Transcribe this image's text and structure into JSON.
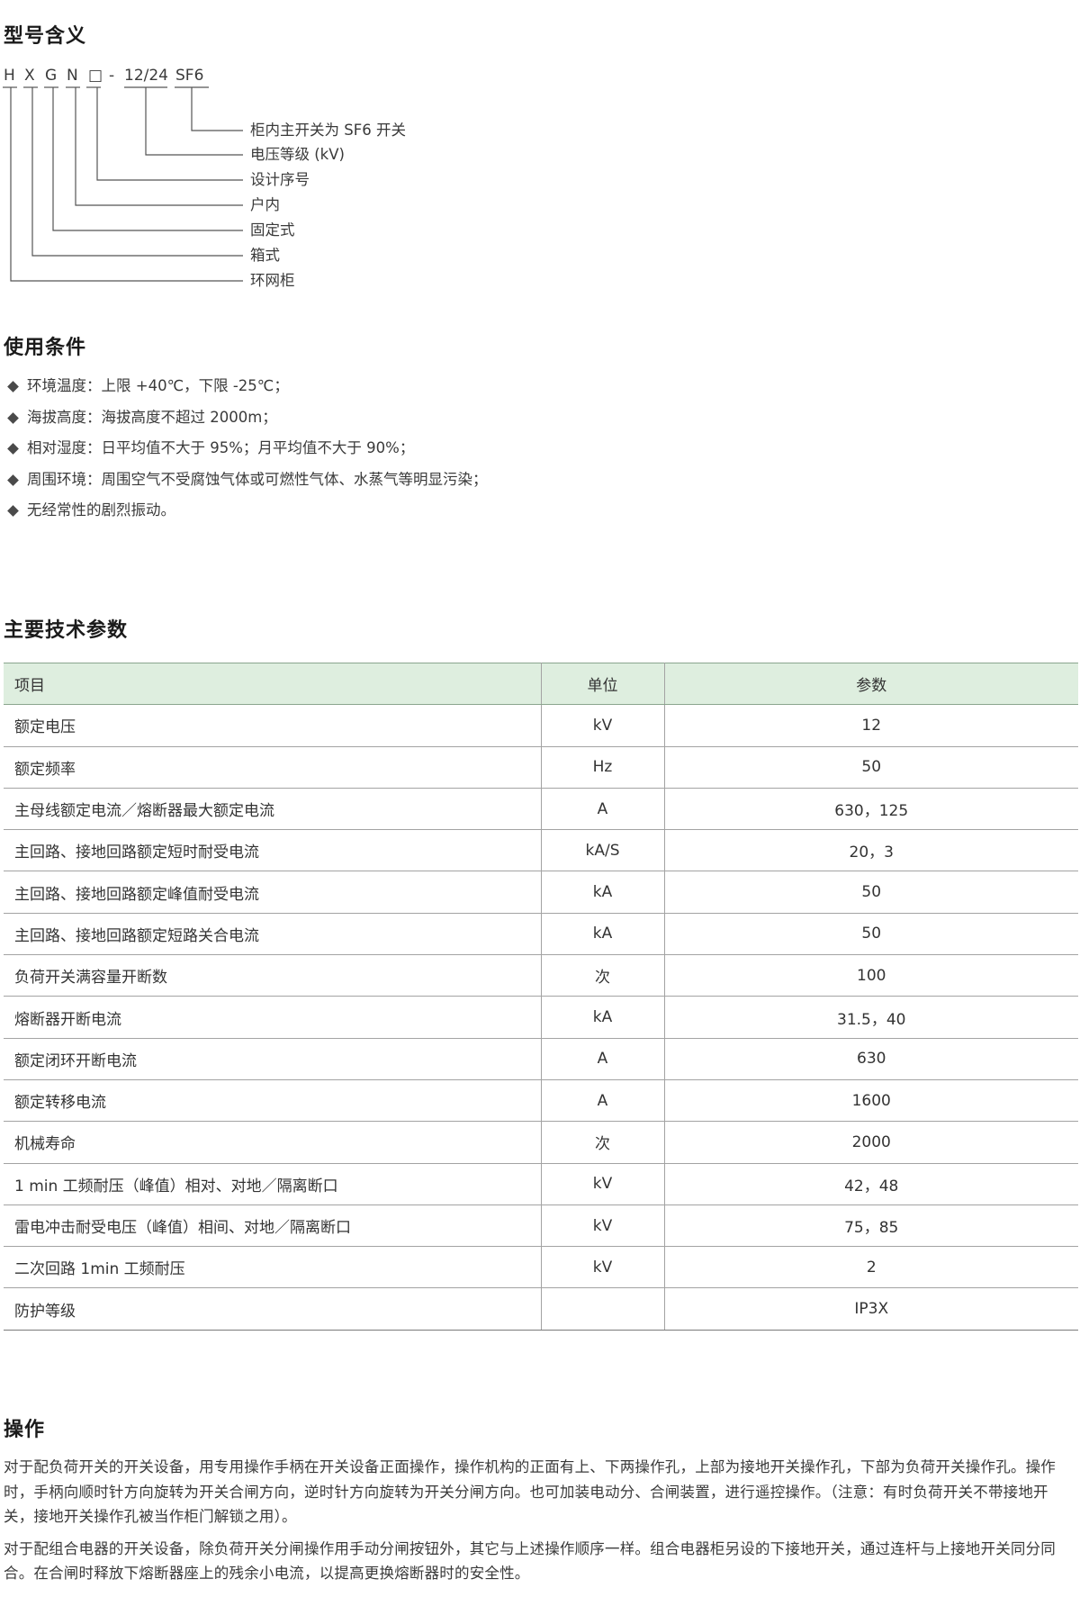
{
  "model_section": {
    "title": "型号含义",
    "code_parts": [
      "H",
      "X",
      "G",
      "N",
      "□",
      "-",
      "12/24",
      "SF6"
    ],
    "meanings": [
      "柜内主开关为 SF6 开关",
      "电压等级 (kV)",
      "设计序号",
      "户内",
      "固定式",
      "箱式",
      "环网柜"
    ]
  },
  "conditions_section": {
    "title": "使用条件",
    "items": [
      "环境温度：上限 +40℃，下限 -25℃；",
      "海拔高度：海拔高度不超过 2000m；",
      "相对湿度：日平均值不大于 95%；月平均值不大于 90%；",
      "周围环境：周围空气不受腐蚀气体或可燃性气体、水蒸气等明显污染；",
      "无经常性的剧烈振动。"
    ]
  },
  "params_section": {
    "title": "主要技术参数",
    "headers": {
      "item": "项目",
      "unit": "单位",
      "value": "参数"
    },
    "rows": [
      {
        "item": "额定电压",
        "unit": "kV",
        "value": "12"
      },
      {
        "item": "额定频率",
        "unit": "Hz",
        "value": "50"
      },
      {
        "item": "主母线额定电流／熔断器最大额定电流",
        "unit": "A",
        "value": "630，125"
      },
      {
        "item": "主回路、接地回路额定短时耐受电流",
        "unit": "kA/S",
        "value": "20，3"
      },
      {
        "item": "主回路、接地回路额定峰值耐受电流",
        "unit": "kA",
        "value": "50"
      },
      {
        "item": "主回路、接地回路额定短路关合电流",
        "unit": "kA",
        "value": "50"
      },
      {
        "item": "负荷开关满容量开断数",
        "unit": "次",
        "value": "100"
      },
      {
        "item": "熔断器开断电流",
        "unit": "kA",
        "value": "31.5，40"
      },
      {
        "item": "额定闭环开断电流",
        "unit": "A",
        "value": "630"
      },
      {
        "item": "额定转移电流",
        "unit": "A",
        "value": "1600"
      },
      {
        "item": "机械寿命",
        "unit": "次",
        "value": "2000"
      },
      {
        "item": "1 min 工频耐压（峰值）相对、对地／隔离断口",
        "unit": "kV",
        "value": "42，48"
      },
      {
        "item": "雷电冲击耐受电压（峰值）相间、对地／隔离断口",
        "unit": "kV",
        "value": "75，85"
      },
      {
        "item": "二次回路 1min 工频耐压",
        "unit": "kV",
        "value": "2"
      },
      {
        "item": "防护等级",
        "unit": "",
        "value": "IP3X"
      }
    ]
  },
  "operation_section": {
    "title": "操作",
    "paragraphs": [
      "对于配负荷开关的开关设备，用专用操作手柄在开关设备正面操作，操作机构的正面有上、下两操作孔，上部为接地开关操作孔，下部为负荷开关操作孔。操作时，手柄向顺时针方向旋转为开关合闸方向，逆时针方向旋转为开关分闸方向。也可加装电动分、合闸装置，进行遥控操作。（注意：有时负荷开关不带接地开关，接地开关操作孔被当作柜门解锁之用）。",
      "对于配组合电器的开关设备，除负荷开关分闸操作用手动分闸按钮外，其它与上述操作顺序一样。组合电器柜另设的下接地开关，通过连杆与上接地开关同分同合。在合闸时释放下熔断器座上的残余小电流，以提高更换熔断器时的安全性。"
    ]
  }
}
